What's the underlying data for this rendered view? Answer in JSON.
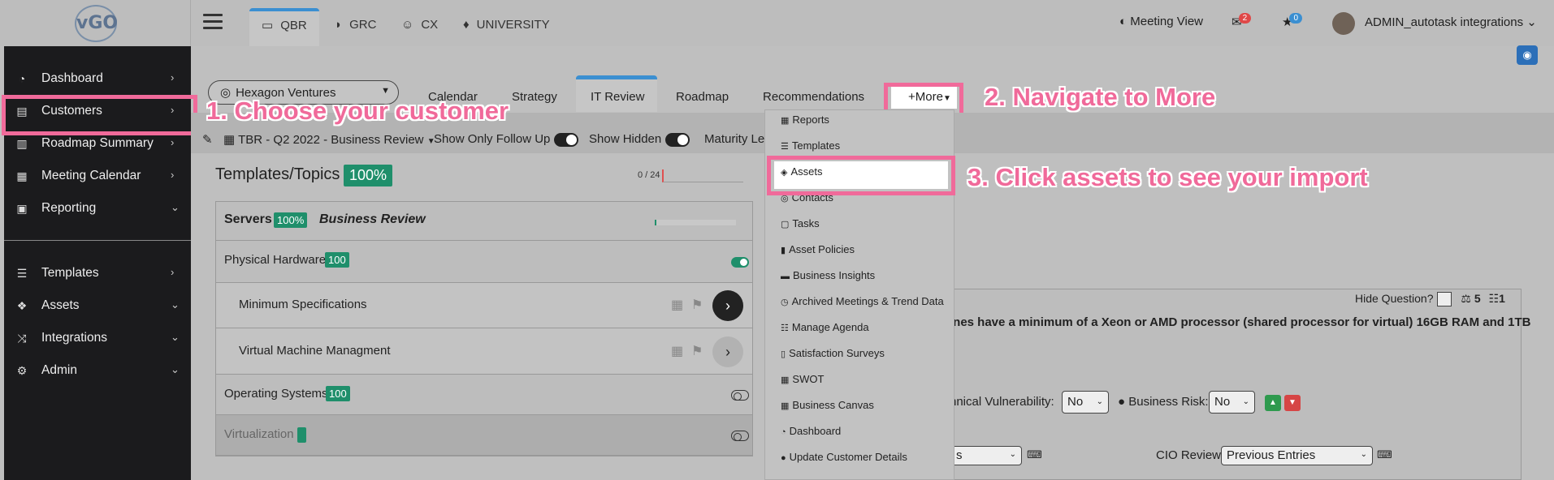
{
  "app": {
    "logo_text": "vGO"
  },
  "sidebar": {
    "items": [
      {
        "label": "Dashboard",
        "icon": "gauge-icon",
        "chev": "›"
      },
      {
        "label": "Customers",
        "icon": "id-card-icon",
        "chev": "›"
      },
      {
        "label": "Roadmap Summary",
        "icon": "map-icon",
        "chev": "›"
      },
      {
        "label": "Meeting Calendar",
        "icon": "calendar-icon",
        "chev": "›"
      },
      {
        "label": "Reporting",
        "icon": "newspaper-icon",
        "chev": "⌄"
      },
      {
        "label": "Templates",
        "icon": "list-icon",
        "chev": "›"
      },
      {
        "label": "Assets",
        "icon": "cubes-icon",
        "chev": "⌄"
      },
      {
        "label": "Integrations",
        "icon": "shuffle-icon",
        "chev": "⌄"
      },
      {
        "label": "Admin",
        "icon": "gears-icon",
        "chev": "⌄"
      }
    ]
  },
  "topnav": {
    "tabs": [
      {
        "label": "QBR",
        "icon": "laptop-icon"
      },
      {
        "label": "GRC",
        "icon": "shield-icon"
      },
      {
        "label": "CX",
        "icon": "smile-icon"
      },
      {
        "label": "UNIVERSITY",
        "icon": "graduation-cap-icon"
      }
    ],
    "meeting_view": "Meeting View",
    "mail_count": "2",
    "star_count": "0",
    "user": "ADMIN_autotask integrations"
  },
  "customer": {
    "selected": "Hexagon Ventures"
  },
  "subtabs": [
    "Calendar",
    "Strategy",
    "IT Review",
    "Roadmap",
    "Recommendations"
  ],
  "more_label": "+More",
  "filters": {
    "meeting": "TBR - Q2 2022 - Business Review",
    "follow_up": "Show Only Follow Up",
    "hidden": "Show Hidden",
    "maturity": "Maturity Le"
  },
  "templates": {
    "title": "Templates/Topics",
    "pct": "100%",
    "counter": "0 / 24",
    "section": {
      "name": "Servers",
      "pct": "100%",
      "type": "Business Review"
    },
    "rows": [
      {
        "label": "Physical Hardware",
        "score": "100"
      },
      {
        "label": "Minimum Specifications"
      },
      {
        "label": "Virtual Machine Managment"
      },
      {
        "label": "Operating Systems",
        "score": "100"
      },
      {
        "label": "Virtualization"
      }
    ]
  },
  "dropdown": {
    "items": [
      {
        "label": "Reports",
        "icon": "grid-icon"
      },
      {
        "label": "Templates",
        "icon": "list-icon"
      },
      {
        "label": "Assets",
        "icon": "cube-icon"
      },
      {
        "label": "Contacts",
        "icon": "user-circle-icon"
      },
      {
        "label": "Tasks",
        "icon": "calendar-icon"
      },
      {
        "label": "Asset Policies",
        "icon": "book-icon"
      },
      {
        "label": "Business Insights",
        "icon": "car-icon"
      },
      {
        "label": "Archived Meetings & Trend Data",
        "icon": "clock-icon"
      },
      {
        "label": "Manage Agenda",
        "icon": "list-ol-icon"
      },
      {
        "label": "Satisfaction Surveys",
        "icon": "thermometer-icon"
      },
      {
        "label": "SWOT",
        "icon": "grid-icon"
      },
      {
        "label": "Business Canvas",
        "icon": "grid-icon"
      },
      {
        "label": "Dashboard",
        "icon": "gauge-icon"
      },
      {
        "label": "Update Customer Details",
        "icon": "user-icon"
      }
    ]
  },
  "question": {
    "hide_label": "Hide Question?",
    "weight": "5",
    "order": "1",
    "text": "ines have a minimum of a Xeon or AMD processor (shared processor for virtual) 16GB RAM and 1TB",
    "tech_vuln_label": "hnical Vulnerability:",
    "tech_vuln_value": "No",
    "biz_risk_label": "Business Risk:",
    "biz_risk_value": "No",
    "left_select_tail": "s",
    "cio_label": "CIO Review",
    "cio_value": "Previous Entries"
  },
  "annotations": {
    "step1": "1. Choose your customer",
    "step2": "2. Navigate to More",
    "step3": "3. Click assets to see your import"
  },
  "colors": {
    "highlight": "#f06a9a",
    "accent": "#3b8fd1",
    "badge_green": "#1f8f6b",
    "sidebar": "#1b1b1d"
  }
}
